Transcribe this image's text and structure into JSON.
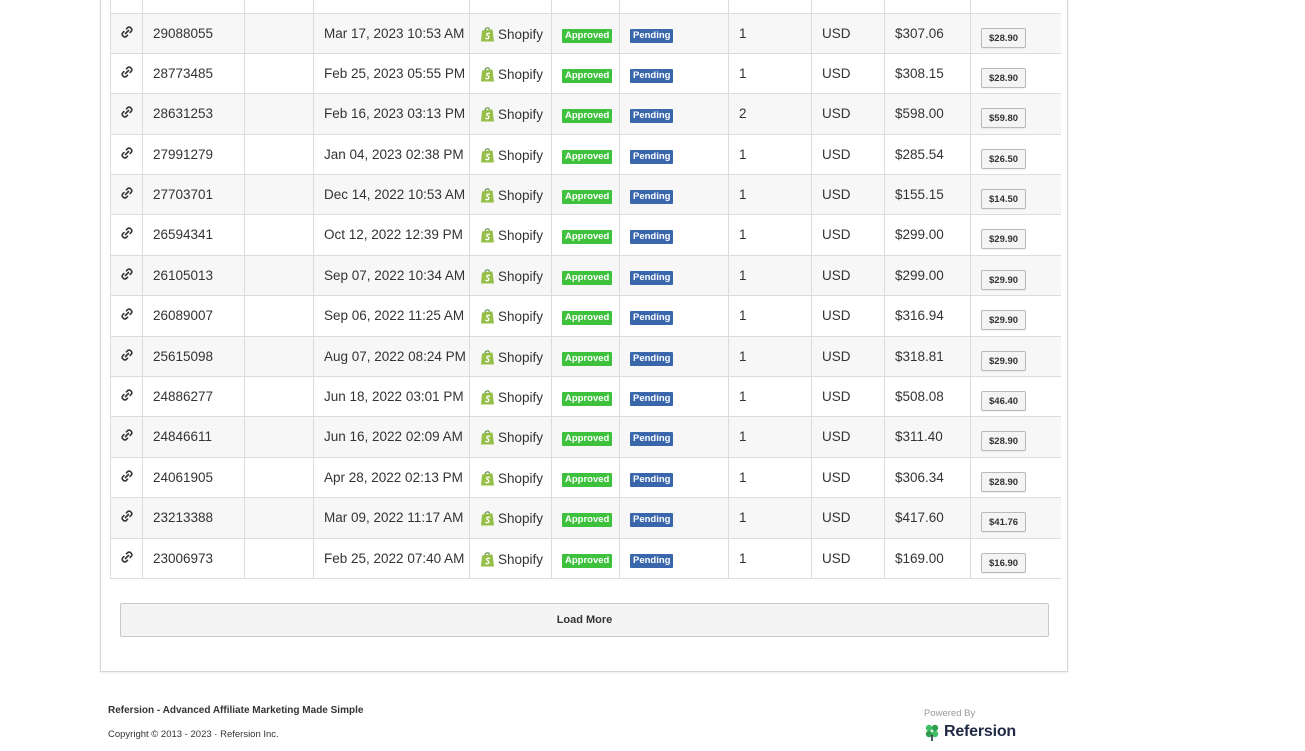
{
  "rows": [
    {
      "order_id": "29088055",
      "date": "Mar 17, 2023 10:53 AM",
      "source": "Shopify",
      "status": "Approved",
      "payout_status": "Pending",
      "items": "1",
      "currency": "USD",
      "total": "$307.06",
      "commission": "$28.90"
    },
    {
      "order_id": "28773485",
      "date": "Feb 25, 2023 05:55 PM",
      "source": "Shopify",
      "status": "Approved",
      "payout_status": "Pending",
      "items": "1",
      "currency": "USD",
      "total": "$308.15",
      "commission": "$28.90"
    },
    {
      "order_id": "28631253",
      "date": "Feb 16, 2023 03:13 PM",
      "source": "Shopify",
      "status": "Approved",
      "payout_status": "Pending",
      "items": "2",
      "currency": "USD",
      "total": "$598.00",
      "commission": "$59.80"
    },
    {
      "order_id": "27991279",
      "date": "Jan 04, 2023 02:38 PM",
      "source": "Shopify",
      "status": "Approved",
      "payout_status": "Pending",
      "items": "1",
      "currency": "USD",
      "total": "$285.54",
      "commission": "$26.50"
    },
    {
      "order_id": "27703701",
      "date": "Dec 14, 2022 10:53 AM",
      "source": "Shopify",
      "status": "Approved",
      "payout_status": "Pending",
      "items": "1",
      "currency": "USD",
      "total": "$155.15",
      "commission": "$14.50"
    },
    {
      "order_id": "26594341",
      "date": "Oct 12, 2022 12:39 PM",
      "source": "Shopify",
      "status": "Approved",
      "payout_status": "Pending",
      "items": "1",
      "currency": "USD",
      "total": "$299.00",
      "commission": "$29.90"
    },
    {
      "order_id": "26105013",
      "date": "Sep 07, 2022 10:34 AM",
      "source": "Shopify",
      "status": "Approved",
      "payout_status": "Pending",
      "items": "1",
      "currency": "USD",
      "total": "$299.00",
      "commission": "$29.90"
    },
    {
      "order_id": "26089007",
      "date": "Sep 06, 2022 11:25 AM",
      "source": "Shopify",
      "status": "Approved",
      "payout_status": "Pending",
      "items": "1",
      "currency": "USD",
      "total": "$316.94",
      "commission": "$29.90"
    },
    {
      "order_id": "25615098",
      "date": "Aug 07, 2022 08:24 PM",
      "source": "Shopify",
      "status": "Approved",
      "payout_status": "Pending",
      "items": "1",
      "currency": "USD",
      "total": "$318.81",
      "commission": "$29.90"
    },
    {
      "order_id": "24886277",
      "date": "Jun 18, 2022 03:01 PM",
      "source": "Shopify",
      "status": "Approved",
      "payout_status": "Pending",
      "items": "1",
      "currency": "USD",
      "total": "$508.08",
      "commission": "$46.40"
    },
    {
      "order_id": "24846611",
      "date": "Jun 16, 2022 02:09 AM",
      "source": "Shopify",
      "status": "Approved",
      "payout_status": "Pending",
      "items": "1",
      "currency": "USD",
      "total": "$311.40",
      "commission": "$28.90"
    },
    {
      "order_id": "24061905",
      "date": "Apr 28, 2022 02:13 PM",
      "source": "Shopify",
      "status": "Approved",
      "payout_status": "Pending",
      "items": "1",
      "currency": "USD",
      "total": "$306.34",
      "commission": "$28.90"
    },
    {
      "order_id": "23213388",
      "date": "Mar 09, 2022 11:17 AM",
      "source": "Shopify",
      "status": "Approved",
      "payout_status": "Pending",
      "items": "1",
      "currency": "USD",
      "total": "$417.60",
      "commission": "$41.76"
    },
    {
      "order_id": "23006973",
      "date": "Feb 25, 2022 07:40 AM",
      "source": "Shopify",
      "status": "Approved",
      "payout_status": "Pending",
      "items": "1",
      "currency": "USD",
      "total": "$169.00",
      "commission": "$16.90"
    }
  ],
  "load_more_label": "Load More",
  "footer": {
    "title": "Refersion - Advanced Affiliate Marketing Made Simple",
    "copyright": "Copyright © 2013 - 2023 · Refersion Inc.",
    "powered_by": "Powered By",
    "brand": "Refersion"
  },
  "icons": {
    "row_link": "link-icon",
    "source": "shopify-bag-icon",
    "brand": "refersion-logo-icon"
  },
  "colors": {
    "approved": "#3ec23e",
    "pending": "#3a67ab",
    "shopify": "#95bf47"
  }
}
